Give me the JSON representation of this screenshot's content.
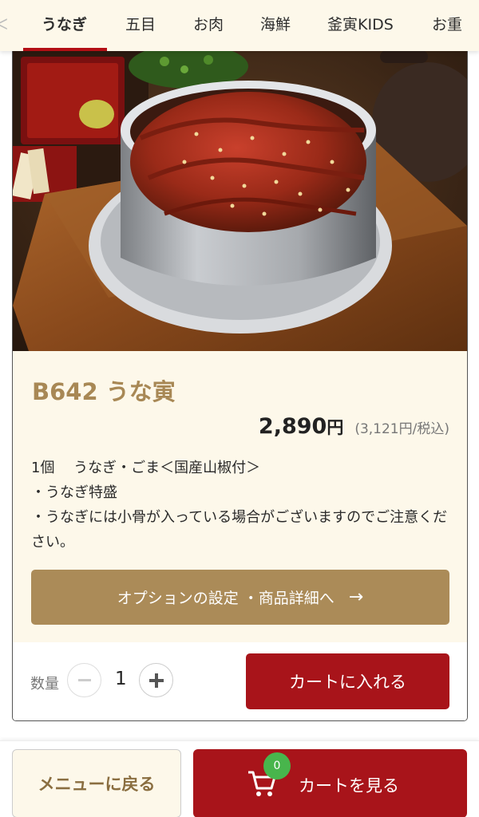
{
  "tabs": [
    {
      "label": "うなぎ",
      "active": true
    },
    {
      "label": "五目",
      "active": false
    },
    {
      "label": "お肉",
      "active": false
    },
    {
      "label": "海鮮",
      "active": false
    },
    {
      "label": "釜寅KIDS",
      "active": false
    },
    {
      "label": "お重",
      "active": false
    }
  ],
  "product": {
    "image_description_icon": "unagi-kamameshi-photo",
    "title": "B642 うな寅",
    "price": "2,890",
    "price_unit": "円",
    "price_tax_included": "(3,121円/税込)",
    "description": [
      "1個　 うなぎ・ごま＜国産山椒付＞",
      "・うなぎ特盛",
      "・うなぎには小骨が入っている場合がございますのでご注意ください。"
    ],
    "option_button_label": "オプションの設定 ・商品詳細へ",
    "option_button_arrow": "→"
  },
  "quantity": {
    "label": "数量",
    "value": "1"
  },
  "add_to_cart_label": "カートに入れる",
  "bottom": {
    "back_label": "メニューに戻る",
    "view_cart_label": "カートを見る",
    "cart_count": "0"
  },
  "colors": {
    "brand_red": "#a8141a",
    "gold": "#ab8b58",
    "cream": "#fdf8ea",
    "badge_green": "#48b54c"
  }
}
